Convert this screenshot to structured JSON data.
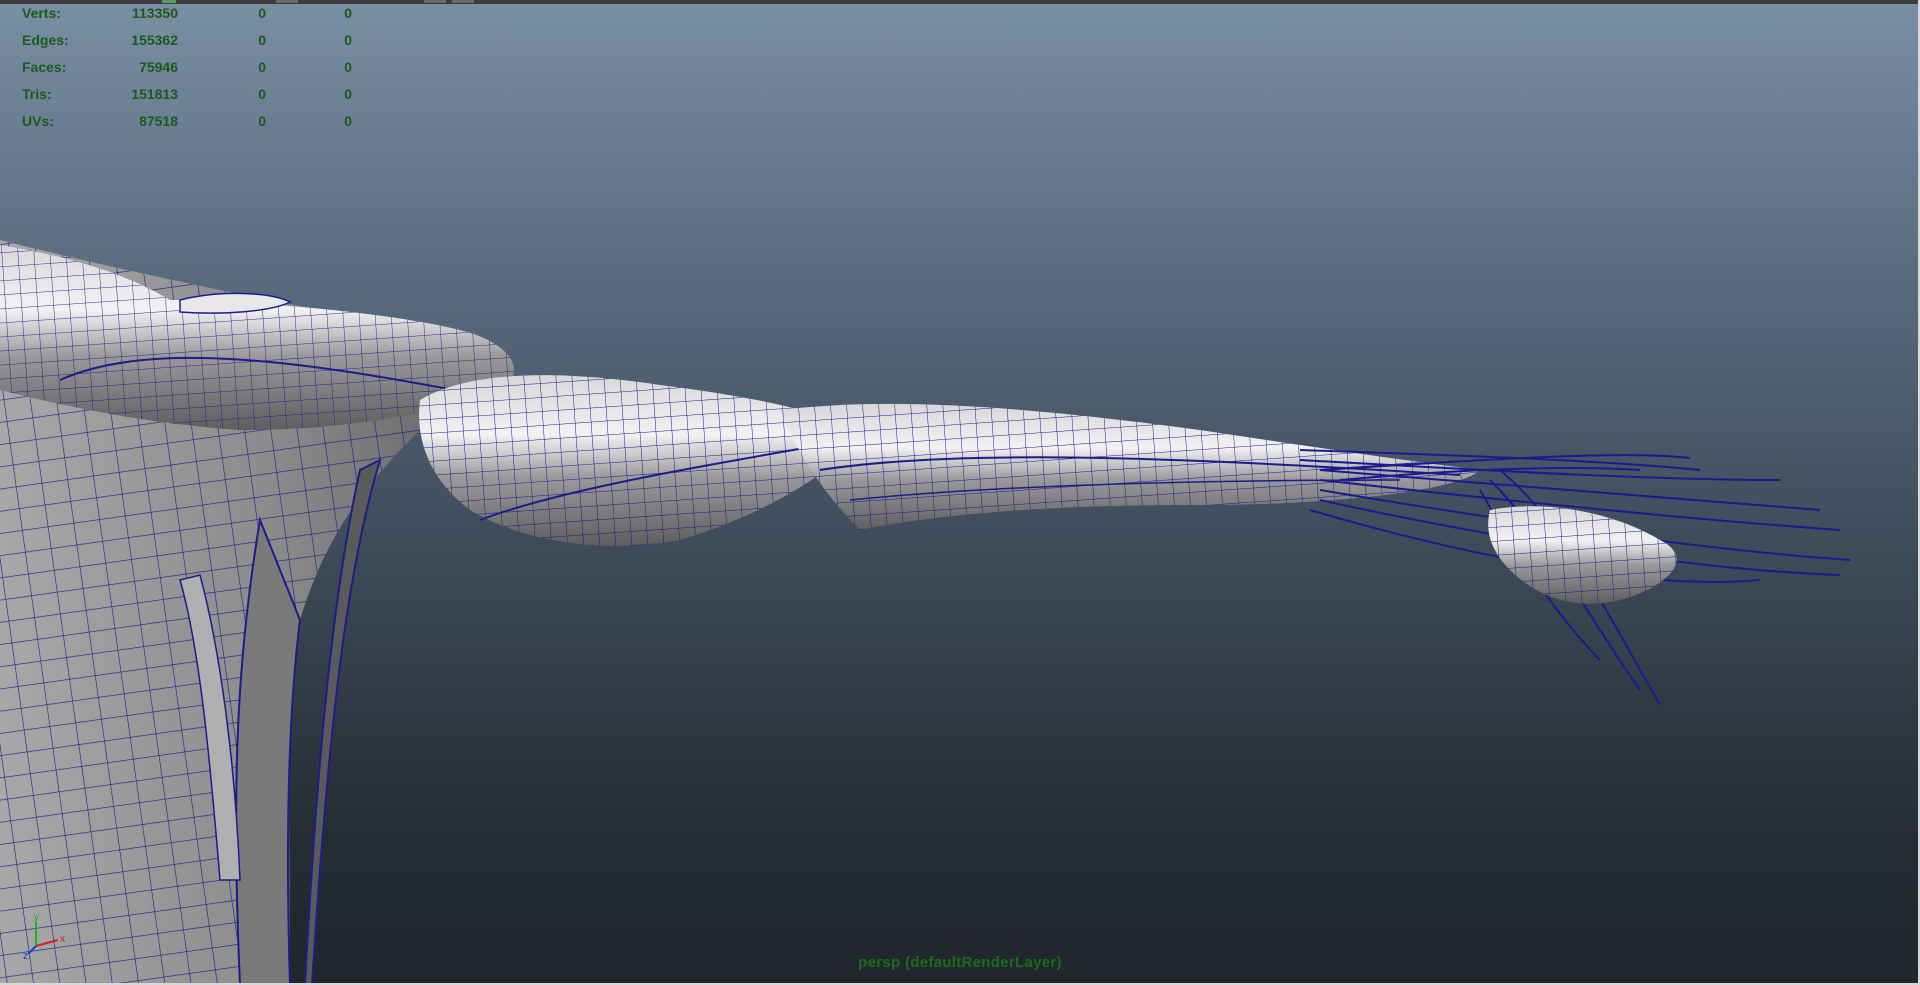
{
  "hud": {
    "rows": [
      {
        "label": "Verts:",
        "total": "113350",
        "selected": "0",
        "component": "0"
      },
      {
        "label": "Edges:",
        "total": "155362",
        "selected": "0",
        "component": "0"
      },
      {
        "label": "Faces:",
        "total": "75946",
        "selected": "0",
        "component": "0"
      },
      {
        "label": "Tris:",
        "total": "151813",
        "selected": "0",
        "component": "0"
      },
      {
        "label": "UVs:",
        "total": "87518",
        "selected": "0",
        "component": "0"
      }
    ]
  },
  "viewport": {
    "camera_label": "persp (defaultRenderLayer)",
    "mesh_subject": "arm-muscle-wireframe",
    "wireframe_color": "#1a1a8c",
    "shaded_color": "#a6a6a6"
  },
  "axis_gizmo": {
    "x_label": "x",
    "y_label": "y",
    "z_label": "z",
    "x_color": "#d02020",
    "y_color": "#20b020",
    "z_color": "#2040d0"
  }
}
